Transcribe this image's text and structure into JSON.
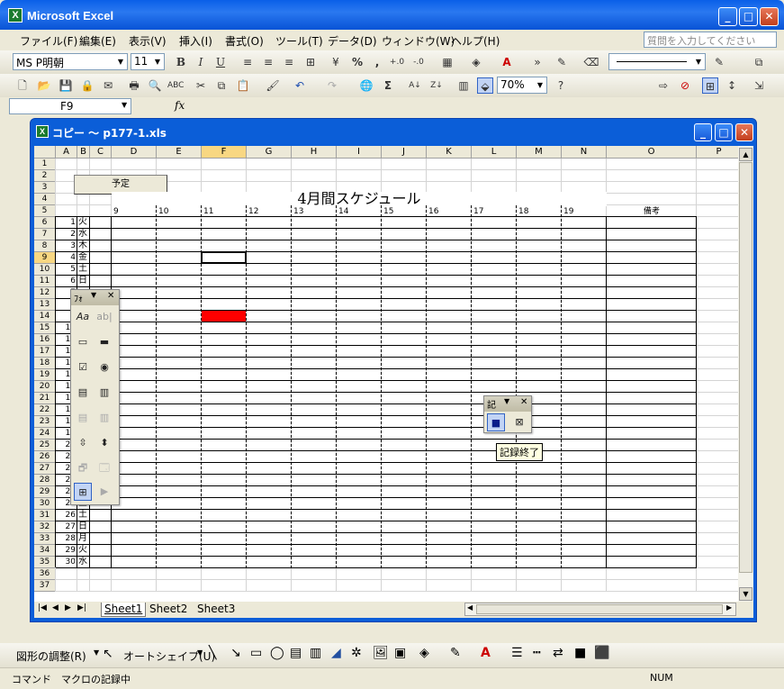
{
  "window": {
    "title": "Microsoft Excel",
    "min": "_",
    "max": "□",
    "close": "✕"
  },
  "menu": [
    "ファイル(F)",
    "編集(E)",
    "表示(V)",
    "挿入(I)",
    "書式(O)",
    "ツール(T)",
    "データ(D)",
    "ウィンドウ(W)",
    "ヘルプ(H)"
  ],
  "help_placeholder": "質問を入力してください",
  "format_toolbar": {
    "font": "MS P明朝",
    "size": "11",
    "bold": "B",
    "italic": "I",
    "underline": "U",
    "percent": "%",
    "comma": ","
  },
  "standard_toolbar": {
    "zoom": "70%",
    "sigma": "Σ"
  },
  "formula": {
    "name_box": "F9",
    "fx": "fx"
  },
  "workbook": {
    "title": "コピー ～ p177-1.xls"
  },
  "columns": [
    "A",
    "B",
    "C",
    "D",
    "E",
    "F",
    "G",
    "H",
    "I",
    "J",
    "K",
    "L",
    "M",
    "N",
    "O",
    "P"
  ],
  "rows": [
    "1",
    "2",
    "3",
    "4",
    "5",
    "6",
    "7",
    "8",
    "9",
    "10",
    "11",
    "12",
    "13",
    "14",
    "15",
    "16",
    "17",
    "18",
    "19",
    "20",
    "21",
    "22",
    "23",
    "24",
    "25",
    "26",
    "27",
    "28",
    "29",
    "30",
    "31",
    "32",
    "33",
    "34",
    "35",
    "36",
    "37"
  ],
  "sheet": {
    "button_label": "予定",
    "title": "4月間スケジュール",
    "hours": [
      "9",
      "10",
      "11",
      "12",
      "13",
      "14",
      "15",
      "16",
      "17",
      "18",
      "19"
    ],
    "notes_header": "備考",
    "days": [
      {
        "n": "1",
        "d": "火"
      },
      {
        "n": "2",
        "d": "水"
      },
      {
        "n": "3",
        "d": "木"
      },
      {
        "n": "4",
        "d": "金"
      },
      {
        "n": "5",
        "d": "土"
      },
      {
        "n": "6",
        "d": "日"
      },
      {
        "n": "7",
        "d": ""
      },
      {
        "n": "8",
        "d": ""
      },
      {
        "n": "9",
        "d": ""
      },
      {
        "n": "10",
        "d": ""
      },
      {
        "n": "11",
        "d": ""
      },
      {
        "n": "12",
        "d": ""
      },
      {
        "n": "13",
        "d": ""
      },
      {
        "n": "14",
        "d": ""
      },
      {
        "n": "15",
        "d": ""
      },
      {
        "n": "16",
        "d": ""
      },
      {
        "n": "17",
        "d": ""
      },
      {
        "n": "18",
        "d": ""
      },
      {
        "n": "19",
        "d": ""
      },
      {
        "n": "20",
        "d": ""
      },
      {
        "n": "21",
        "d": ""
      },
      {
        "n": "22",
        "d": ""
      },
      {
        "n": "23",
        "d": ""
      },
      {
        "n": "24",
        "d": ""
      },
      {
        "n": "25",
        "d": "金"
      },
      {
        "n": "26",
        "d": "土"
      },
      {
        "n": "27",
        "d": "日"
      },
      {
        "n": "28",
        "d": "月"
      },
      {
        "n": "29",
        "d": "火"
      },
      {
        "n": "30",
        "d": "水"
      }
    ],
    "highlight_color": "#ff0000"
  },
  "sheet_tabs": [
    "Sheet1",
    "Sheet2",
    "Sheet3"
  ],
  "forms_toolbar": {
    "title": "ﾌｫ",
    "close": "✕"
  },
  "record_toolbar": {
    "title": "記",
    "close": "✕",
    "tooltip": "記録終了"
  },
  "drawing_toolbar": {
    "adjust": "図形の調整(R)",
    "autoshape": "オートシェイプ(U)"
  },
  "status": {
    "mode": "コマンド",
    "message": "マクロの記録中",
    "num": "NUM"
  }
}
